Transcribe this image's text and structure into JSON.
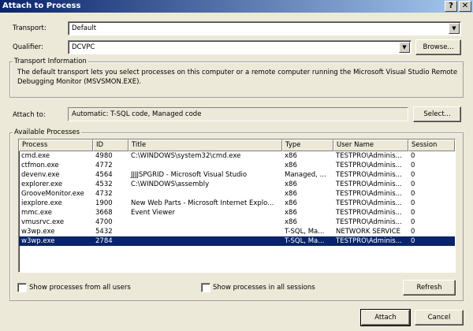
{
  "window": {
    "title": "Attach to Process",
    "help_glyph": "?",
    "close_glyph": "✕"
  },
  "transport": {
    "label": "Transport:",
    "value": "Default"
  },
  "qualifier": {
    "label": "Qualifier:",
    "value": "DCVPC",
    "browse_label": "Browse..."
  },
  "transport_info": {
    "group_label": "Transport Information",
    "text": "The default transport lets you select processes on this computer or a remote computer running the Microsoft Visual Studio Remote Debugging Monitor (MSVSMON.EXE)."
  },
  "attach_to": {
    "label": "Attach to:",
    "value": "Automatic: T-SQL code, Managed code",
    "select_label": "Select..."
  },
  "processes": {
    "group_label": "Available Processes",
    "columns": [
      "Process",
      "ID",
      "Title",
      "Type",
      "User Name",
      "Session"
    ],
    "rows": [
      [
        "cmd.exe",
        "4980",
        "C:\\WINDOWS\\system32\\cmd.exe",
        "x86",
        "TESTPRO\\Adminis...",
        "0"
      ],
      [
        "ctfmon.exe",
        "4772",
        "",
        "x86",
        "TESTPRO\\Adminis...",
        "0"
      ],
      [
        "devenv.exe",
        "4564",
        "JJJJSPGRID - Microsoft Visual Studio",
        "Managed, ...",
        "TESTPRO\\Adminis...",
        "0"
      ],
      [
        "explorer.exe",
        "4532",
        "C:\\WINDOWS\\assembly",
        "x86",
        "TESTPRO\\Adminis...",
        "0"
      ],
      [
        "GrooveMonitor.exe",
        "4732",
        "",
        "x86",
        "TESTPRO\\Adminis...",
        "0"
      ],
      [
        "iexplore.exe",
        "1900",
        "New Web Parts - Microsoft Internet Explo...",
        "x86",
        "TESTPRO\\Adminis...",
        "0"
      ],
      [
        "mmc.exe",
        "3668",
        "Event Viewer",
        "x86",
        "TESTPRO\\Adminis...",
        "0"
      ],
      [
        "vmusrvc.exe",
        "4700",
        "",
        "x86",
        "TESTPRO\\Adminis...",
        "0"
      ],
      [
        "w3wp.exe",
        "5432",
        "",
        "T-SQL, Ma...",
        "NETWORK SERVICE",
        "0"
      ],
      [
        "w3wp.exe",
        "2784",
        "",
        "T-SQL, Ma...",
        "TESTPRO\\Adminis...",
        "0"
      ]
    ],
    "selected_row": 9
  },
  "options": {
    "show_all_users": "Show processes from all users",
    "show_all_sessions": "Show processes in all sessions",
    "refresh_label": "Refresh"
  },
  "footer": {
    "attach_label": "Attach",
    "cancel_label": "Cancel"
  },
  "colors": {
    "titlebar_start": "#0a246a",
    "titlebar_end": "#a6caf0",
    "selection": "#0a246a",
    "dialog_bg": "#ece9d8"
  }
}
